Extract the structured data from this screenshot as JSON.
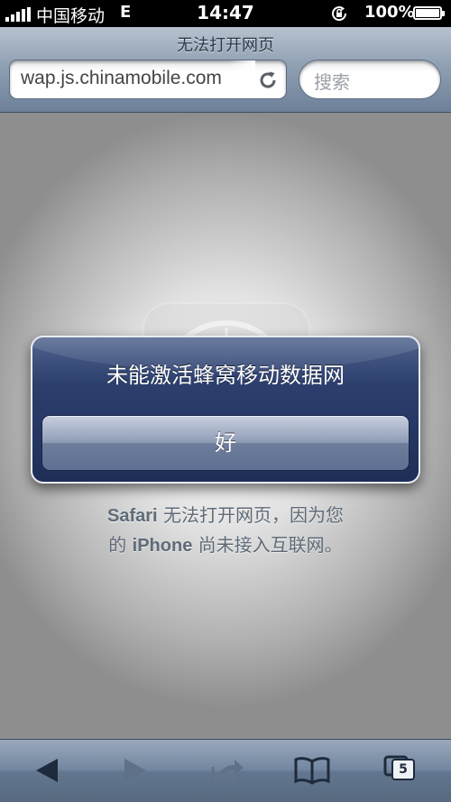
{
  "status_bar": {
    "carrier": "中国移动",
    "network": "E",
    "time": "14:47",
    "battery": "100%"
  },
  "safari": {
    "page_title": "无法打开网页",
    "url": "wap.js.chinamobile.com",
    "search_placeholder": "搜索"
  },
  "alert": {
    "title": "未能激活蜂窝移动数据网",
    "button_label": "好"
  },
  "content": {
    "error_line1_bold": "Safari",
    "error_line1_rest": " 无法打开网页，因为您",
    "error_line2_pre": "的 ",
    "error_line2_bold": "iPhone",
    "error_line2_rest": " 尚未接入互联网。"
  },
  "toolbar": {
    "tabs_count": "5",
    "icons": [
      "back-icon",
      "forward-icon",
      "share-icon",
      "bookmarks-icon",
      "tabs-icon"
    ]
  }
}
